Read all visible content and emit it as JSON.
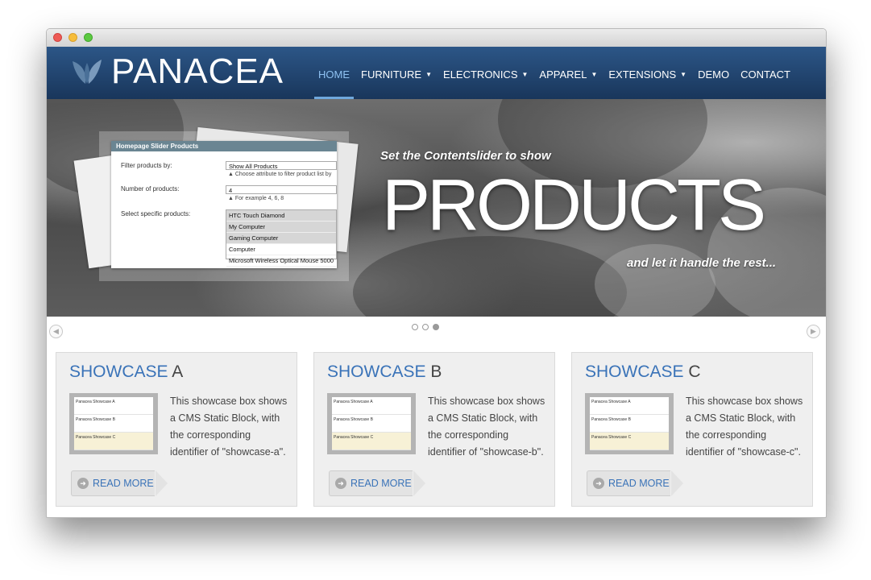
{
  "brand": {
    "name": "PANACEA",
    "header_gradient": [
      "#2c5687",
      "#19365b"
    ],
    "accent": "#3a73b8"
  },
  "nav": [
    {
      "label": "HOME",
      "active": true
    },
    {
      "label": "FURNITURE",
      "dropdown": true
    },
    {
      "label": "ELECTRONICS",
      "dropdown": true
    },
    {
      "label": "APPAREL",
      "dropdown": true
    },
    {
      "label": "EXTENSIONS",
      "dropdown": true
    },
    {
      "label": "DEMO"
    },
    {
      "label": "CONTACT"
    }
  ],
  "slider": {
    "tagline_top": "Set the Contentslider to show",
    "headline": "PRODUCTS",
    "tagline_bottom": "and let it handle the rest...",
    "panel": {
      "title": "Homepage Slider Products",
      "filter_label": "Filter products by:",
      "filter_value": "Show All Products",
      "filter_hint": "Choose attribute to filter product list by",
      "count_label": "Number of products:",
      "count_value": "4",
      "count_hint": "For example 4, 6, 8",
      "select_label": "Select specific products:",
      "products": [
        "HTC Touch Diamond",
        "My Computer",
        "Gaming Computer",
        "Computer",
        "Microsoft Wireless Optical Mouse 5000"
      ]
    },
    "active_dot": 3
  },
  "showcases": [
    {
      "title": "SHOWCASE",
      "letter": "A",
      "text": "This showcase box shows a CMS Static Block, with the corresponding identifier of \"showcase-a\".",
      "button": "READ MORE",
      "thumb_rows": [
        "Panacea Showcase A",
        "Panacea Showcase B",
        "Panacea Showcase C"
      ]
    },
    {
      "title": "SHOWCASE",
      "letter": "B",
      "text": "This showcase box shows a CMS Static Block, with the corresponding identifier of \"showcase-b\".",
      "button": "READ MORE",
      "thumb_rows": [
        "Panacea Showcase A",
        "Panacea Showcase B",
        "Panacea Showcase C"
      ]
    },
    {
      "title": "SHOWCASE",
      "letter": "C",
      "text": "This showcase box shows a CMS Static Block, with the corresponding identifier of \"showcase-c\".",
      "button": "READ MORE",
      "thumb_rows": [
        "Panacea Showcase A",
        "Panacea Showcase B",
        "Panacea Showcase C"
      ]
    }
  ]
}
